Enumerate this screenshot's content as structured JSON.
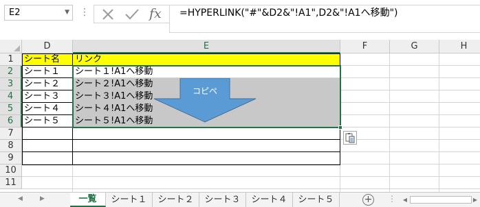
{
  "formula_bar": {
    "name_box": "E2",
    "formula": "=HYPERLINK(\"#\"&D2&\"!A1\",D2&\"!A1へ移動\")",
    "icons": [
      "more-vert-icon",
      "cancel-x-icon",
      "enter-check-icon",
      "fx-icon"
    ],
    "fx_label": "fx"
  },
  "grid": {
    "columns": [
      "D",
      "E",
      "F",
      "G",
      "H"
    ],
    "rows": [
      "1",
      "2",
      "3",
      "4",
      "5",
      "6",
      "7",
      "8",
      "9",
      "10",
      "11"
    ],
    "selected_column": "E",
    "selected_rows": [
      "2",
      "3",
      "4",
      "5",
      "6"
    ],
    "header": {
      "col_d": "シート名",
      "col_e": "リンク"
    },
    "data_rows": [
      {
        "d": "シート１",
        "e": "シート１!A1へ移動"
      },
      {
        "d": "シート２",
        "e": "シート２!A1へ移動"
      },
      {
        "d": "シート３",
        "e": "シート３!A1へ移動"
      },
      {
        "d": "シート４",
        "e": "シート４!A1へ移動"
      },
      {
        "d": "シート５",
        "e": "シート５!A1へ移動"
      }
    ],
    "arrow_label": "コピペ",
    "colors": {
      "header_fill": "#ffff00",
      "selection_fill": "#c8c8c8",
      "selection_border": "#217346",
      "arrow_fill": "#5b9bd5"
    }
  },
  "sheet_tabs": {
    "tabs": [
      "一覧",
      "シート１",
      "シート２",
      "シート３",
      "シート４",
      "シート５"
    ],
    "active": "一覧",
    "add_sheet": "⊕"
  }
}
